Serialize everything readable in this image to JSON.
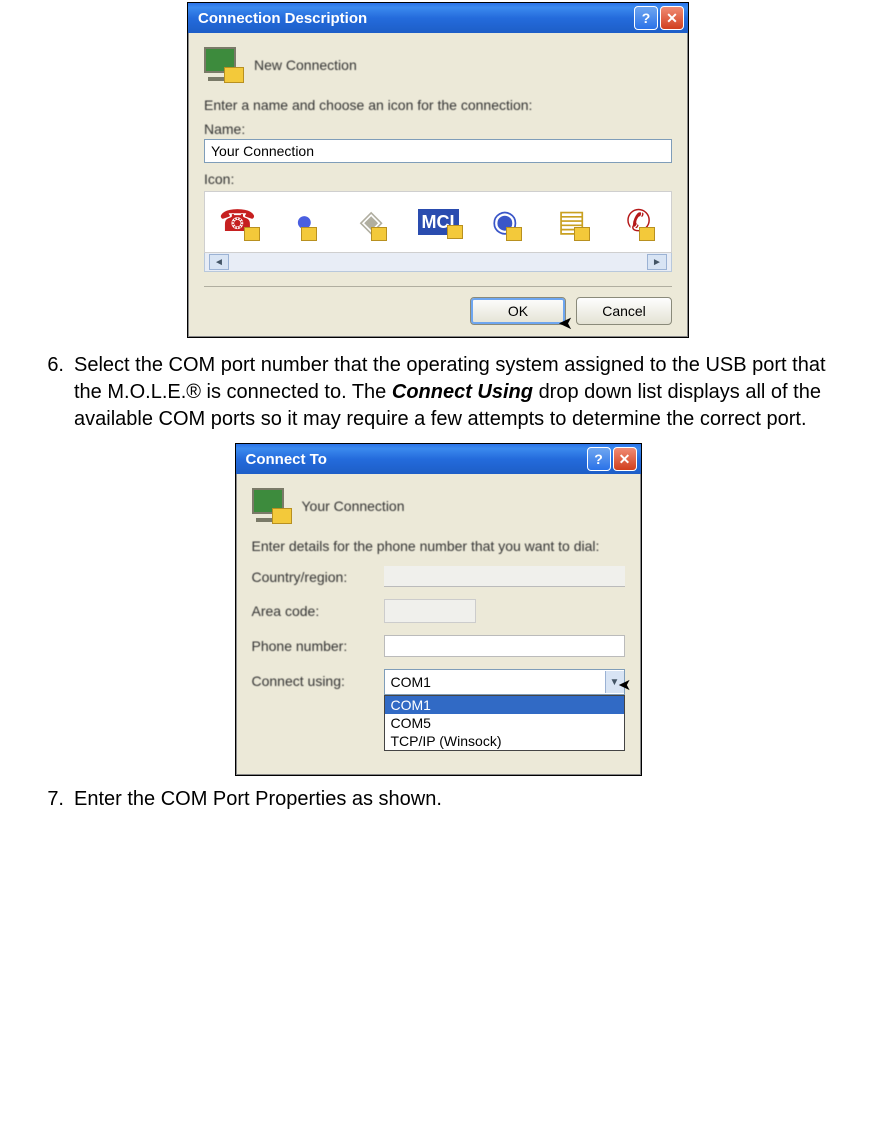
{
  "dialog1": {
    "title": "Connection Description",
    "header_caption": "New Connection",
    "instruction": "Enter a name and choose an icon for the connection:",
    "name_label": "Name:",
    "name_value": "Your Connection",
    "icon_label": "Icon:",
    "ok_label": "OK",
    "cancel_label": "Cancel"
  },
  "step6": {
    "num": "6.",
    "pre": "Select the COM port number that the operating system assigned to the USB port that the M.O.L.E.® is connected to. The ",
    "em": "Connect Using",
    "post": " drop down list displays all of the available COM ports so it may require a few attempts to determine the correct port."
  },
  "dialog2": {
    "title": "Connect To",
    "conn_name": "Your Connection",
    "instruction": "Enter details for the phone number that you want to dial:",
    "country_label": "Country/region:",
    "area_label": "Area code:",
    "phone_label": "Phone number:",
    "connect_label": "Connect using:",
    "connect_value": "COM1",
    "options": {
      "0": "COM1",
      "1": "COM5",
      "2": "TCP/IP (Winsock)"
    }
  },
  "step7": {
    "num": "7.",
    "text": "Enter the COM Port Properties as shown."
  }
}
